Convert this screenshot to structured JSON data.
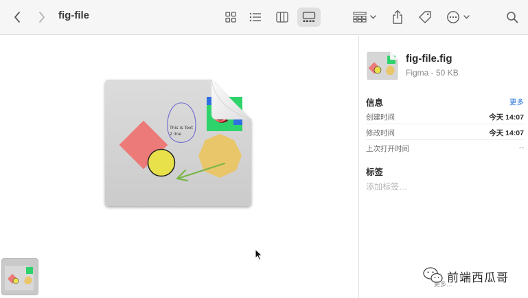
{
  "window": {
    "title": "fig-file"
  },
  "toolbar": {
    "back_icon": "chevron-left-icon",
    "forward_icon": "chevron-right-icon",
    "views": [
      "icon-view",
      "list-view",
      "column-view",
      "gallery-view"
    ],
    "active_view": "gallery-view"
  },
  "preview": {
    "doc_text_line1": "This is Text",
    "doc_text_line2": "2 line"
  },
  "info": {
    "file_name": "fig-file.fig",
    "file_kind": "Figma - 50 KB",
    "info_section_title": "信息",
    "more_label": "更多",
    "rows": [
      {
        "key": "创建时间",
        "value": "今天 14:07"
      },
      {
        "key": "修改时间",
        "value": "今天 14:07"
      },
      {
        "key": "上次打开时间",
        "value": "--"
      }
    ],
    "tags_section_title": "标签",
    "tags_placeholder": "添加标签…"
  },
  "watermark": {
    "text": "前端西瓜哥",
    "sub": "更多..."
  },
  "colors": {
    "toolbar_bg": "#f6f6f6",
    "accent": "#2a74d9",
    "diamond": "#ec7a78",
    "circle": "#e8e14a",
    "heptagon": "#e9c66a",
    "arrow": "#7ab648",
    "doc_bg": "#d4d4d4"
  }
}
